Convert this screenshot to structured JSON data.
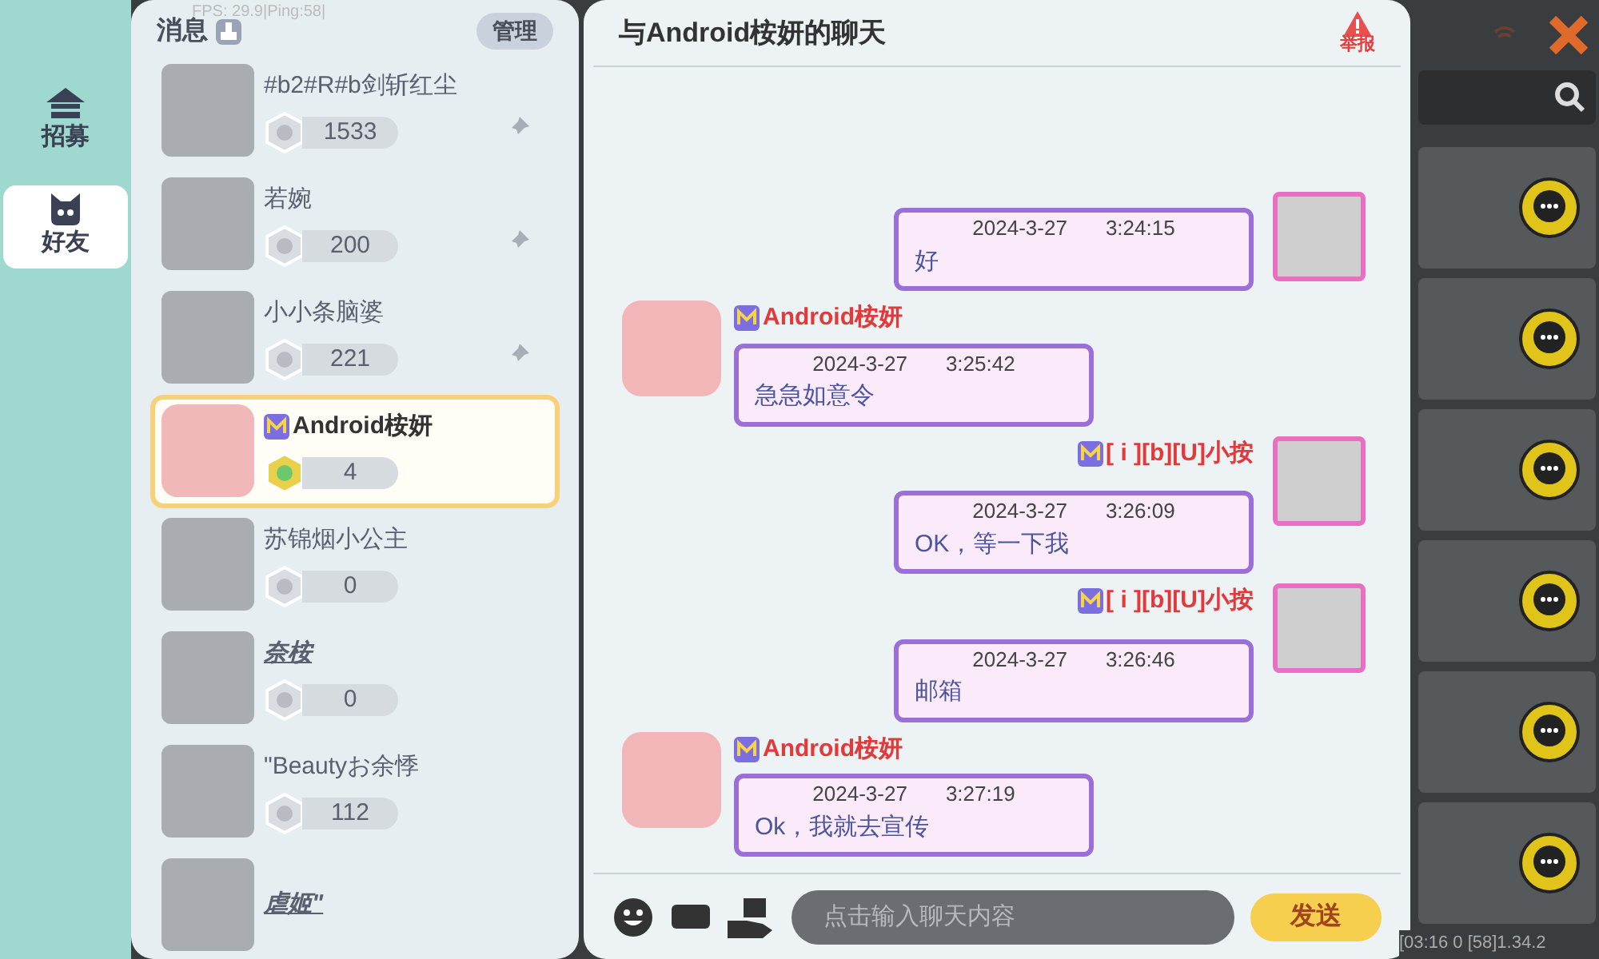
{
  "debug_overlay": "FPS: 29.9|Ping:58|",
  "version_text": "[03:16 0 [58]1.34.2",
  "nav": [
    {
      "label": "招募",
      "selected": false
    },
    {
      "label": "好友",
      "selected": true
    }
  ],
  "friends_panel": {
    "title": "消息",
    "manage_button": "管理",
    "items": [
      {
        "name": "#b2#R#b剑斩红尘",
        "count": "1533",
        "pinned": true,
        "selected": false,
        "vip": false,
        "italic": false
      },
      {
        "name": "若婉",
        "count": "200",
        "pinned": true,
        "selected": false,
        "vip": false,
        "italic": false
      },
      {
        "name": "小小条脑婆",
        "count": "221",
        "pinned": true,
        "selected": false,
        "vip": false,
        "italic": false
      },
      {
        "name": "Android桉妍",
        "count": "4",
        "pinned": false,
        "selected": true,
        "vip": true,
        "italic": false
      },
      {
        "name": "苏锦烟小公主",
        "count": "0",
        "pinned": false,
        "selected": false,
        "vip": false,
        "italic": false
      },
      {
        "name": "奈桉",
        "count": "0",
        "pinned": false,
        "selected": false,
        "vip": false,
        "italic": true
      },
      {
        "name": "\"Beautyお余悸",
        "count": "112",
        "pinned": false,
        "selected": false,
        "vip": false,
        "italic": false
      },
      {
        "name": "虐姬\"",
        "pinned": false,
        "selected": false,
        "vip": false,
        "italic": true
      }
    ]
  },
  "chat": {
    "title": "与Android桉妍的聊天",
    "report_label": "举报",
    "messages": [
      {
        "kind": "self",
        "date": "2024-3-27",
        "time": "3:24:15",
        "text": "好"
      },
      {
        "kind": "other",
        "name": "Android桉妍",
        "date": "2024-3-27",
        "time": "3:25:42",
        "text": "急急如意令"
      },
      {
        "kind": "self",
        "name": "[ i ][b][U]小按",
        "date": "2024-3-27",
        "time": "3:26:09",
        "text": "OK，等一下我"
      },
      {
        "kind": "self",
        "name": "[ i ][b][U]小按",
        "date": "2024-3-27",
        "time": "3:26:46",
        "text": "邮箱"
      },
      {
        "kind": "other",
        "name": "Android桉妍",
        "date": "2024-3-27",
        "time": "3:27:19",
        "text": "Ok，我就去宣传"
      }
    ],
    "input_placeholder": "点击输入聊天内容",
    "send_button": "发送"
  }
}
